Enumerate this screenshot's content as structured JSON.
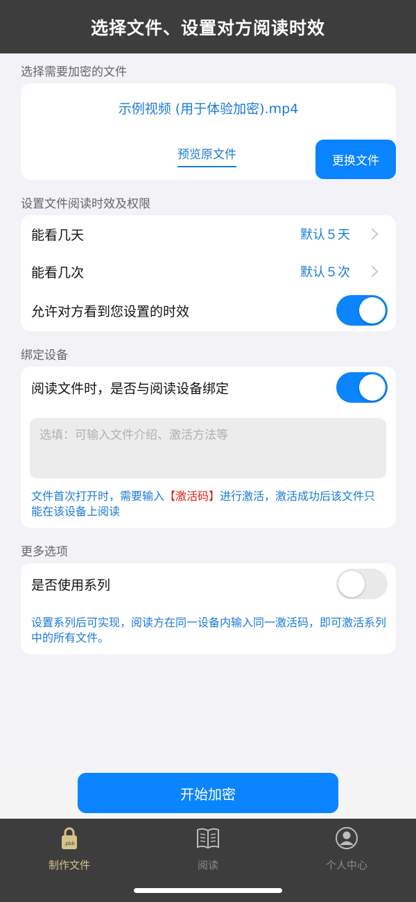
{
  "header": {
    "title": "选择文件、设置对方阅读时效"
  },
  "section_file": {
    "title": "选择需要加密的文件",
    "file_name": "示例视频 (用于体验加密).mp4",
    "preview_label": "预览原文件",
    "change_label": "更换文件"
  },
  "section_limits": {
    "title": "设置文件阅读时效及权限",
    "days_label": "能看几天",
    "days_value": "默认５天",
    "times_label": "能看几次",
    "times_value": "默认５次",
    "show_limit_label": "允许对方看到您设置的时效",
    "show_limit_on": true
  },
  "section_device": {
    "title": "绑定设备",
    "bind_label": "阅读文件时，是否与阅读设备绑定",
    "bind_on": true,
    "input_placeholder": "选填：可输入文件介绍、激活方法等",
    "note_before": "文件首次打开时，需要输入",
    "note_highlight": "【激活码】",
    "note_after": "进行激活，激活成功后该文件只能在该设备上阅读"
  },
  "section_more": {
    "title": "更多选项",
    "series_label": "是否使用系列",
    "series_on": false,
    "note": "设置系列后可实现，阅读方在同一设备内输入同一激活码，即可激活系列中的所有文件。"
  },
  "start_button": "开始加密",
  "tabs": [
    {
      "label": "制作文件",
      "icon": "lock-file-icon",
      "active": true
    },
    {
      "label": "阅读",
      "icon": "book-icon",
      "active": false
    },
    {
      "label": "个人中心",
      "icon": "user-icon",
      "active": false
    }
  ],
  "colors": {
    "accent": "#0a84ff",
    "link": "#1a7ad6",
    "highlight": "#e0201b",
    "header": "#3d3d3d",
    "active_tab": "#d7c28a"
  }
}
